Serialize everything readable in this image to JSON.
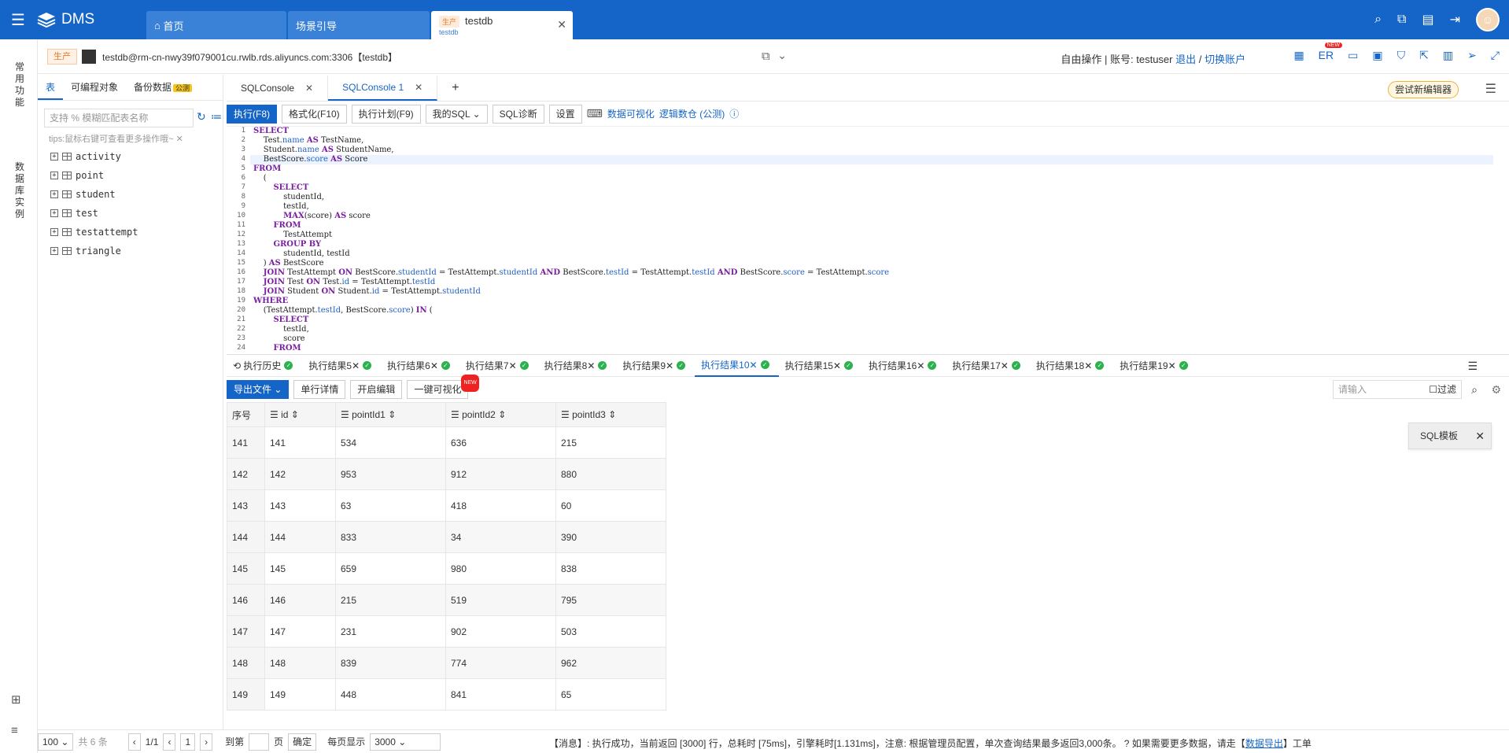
{
  "app": {
    "name": "DMS"
  },
  "top_tabs": [
    {
      "label": "首页"
    },
    {
      "label": "场景引导"
    },
    {
      "label": "testdb",
      "env": "生产",
      "sub": "testdb"
    }
  ],
  "left_rail": {
    "item1": "常用功能",
    "item2": "数据库实例"
  },
  "conn": {
    "env": "生产",
    "value": "testdb@rm-cn-nwy39f079001cu.rwlb.rds.aliyuncs.com:3306【testdb】",
    "mode": "自由操作 | 账号: testuser",
    "logout": "退出",
    "switch": "切换账户",
    "er": "ER",
    "new": "NEW"
  },
  "sidebar": {
    "tabs": [
      "表",
      "可编程对象",
      "备份数据"
    ],
    "backup_badge": "公测",
    "search_placeholder": "支持 % 模糊匹配表名称",
    "tips": "tips:鼠标右键可查看更多操作哦~",
    "tables": [
      "activity",
      "point",
      "student",
      "test",
      "testattempt",
      "triangle"
    ]
  },
  "console_tabs": [
    {
      "label": "SQLConsole"
    },
    {
      "label": "SQLConsole 1"
    }
  ],
  "try_new": "尝试新编辑器",
  "toolbar": {
    "run": "执行(F8)",
    "format": "格式化(F10)",
    "plan": "执行计划(F9)",
    "mysql": "我的SQL",
    "diag": "SQL诊断",
    "settings": "设置",
    "viz": "数据可视化",
    "logic": "逻辑数仓 (公测)"
  },
  "sql_lines": [
    "SELECT",
    "    Test.name AS TestName,",
    "    Student.name AS StudentName,",
    "    BestScore.score AS Score",
    "FROM",
    "    (",
    "        SELECT",
    "            studentId,",
    "            testId,",
    "            MAX(score) AS score",
    "        FROM",
    "            TestAttempt",
    "        GROUP BY",
    "            studentId, testId",
    "    ) AS BestScore",
    "    JOIN TestAttempt ON BestScore.studentId = TestAttempt.studentId AND BestScore.testId = TestAttempt.testId AND BestScore.score = TestAttempt.score",
    "    JOIN Test ON Test.id = TestAttempt.testId",
    "    JOIN Student ON Student.id = TestAttempt.studentId",
    "WHERE",
    "    (TestAttempt.testId, BestScore.score) IN (",
    "        SELECT",
    "            testId,",
    "            score",
    "        FROM"
  ],
  "result_tabs": [
    "执行历史",
    "执行结果5",
    "执行结果6",
    "执行结果7",
    "执行结果8",
    "执行结果9",
    "执行结果10",
    "执行结果15",
    "执行结果16",
    "执行结果17",
    "执行结果18",
    "执行结果19"
  ],
  "result_toolbar": {
    "export": "导出文件",
    "detail": "单行详情",
    "edit": "开启编辑",
    "viz": "一键可视化",
    "new": "NEW",
    "filter_placeholder": "请输入",
    "filter": "过滤"
  },
  "sql_template": "SQL模板",
  "columns": [
    "序号",
    "id",
    "pointId1",
    "pointId2",
    "pointId3"
  ],
  "rows": [
    [
      "141",
      "141",
      "534",
      "636",
      "215"
    ],
    [
      "142",
      "142",
      "953",
      "912",
      "880"
    ],
    [
      "143",
      "143",
      "63",
      "418",
      "60"
    ],
    [
      "144",
      "144",
      "833",
      "34",
      "390"
    ],
    [
      "145",
      "145",
      "659",
      "980",
      "838"
    ],
    [
      "146",
      "146",
      "215",
      "519",
      "795"
    ],
    [
      "147",
      "147",
      "231",
      "902",
      "503"
    ],
    [
      "148",
      "148",
      "839",
      "774",
      "962"
    ],
    [
      "149",
      "149",
      "448",
      "841",
      "65"
    ]
  ],
  "footer": {
    "page_size": "100",
    "total": "共 6 条",
    "page": "1/1",
    "page_input": "1",
    "goto": "到第",
    "page_unit": "页",
    "confirm": "确定",
    "per_page_label": "每页显示",
    "per_page": "3000",
    "message": "【消息】: 执行成功，当前返回 [3000] 行，总耗时 [75ms]，引擎耗时[1.131ms]，注意: 根据管理员配置，单次查询结果最多返回3,000条。",
    "more": "如果需要更多数据，请走【",
    "export_link": "数据导出",
    "more_end": "】工单"
  }
}
